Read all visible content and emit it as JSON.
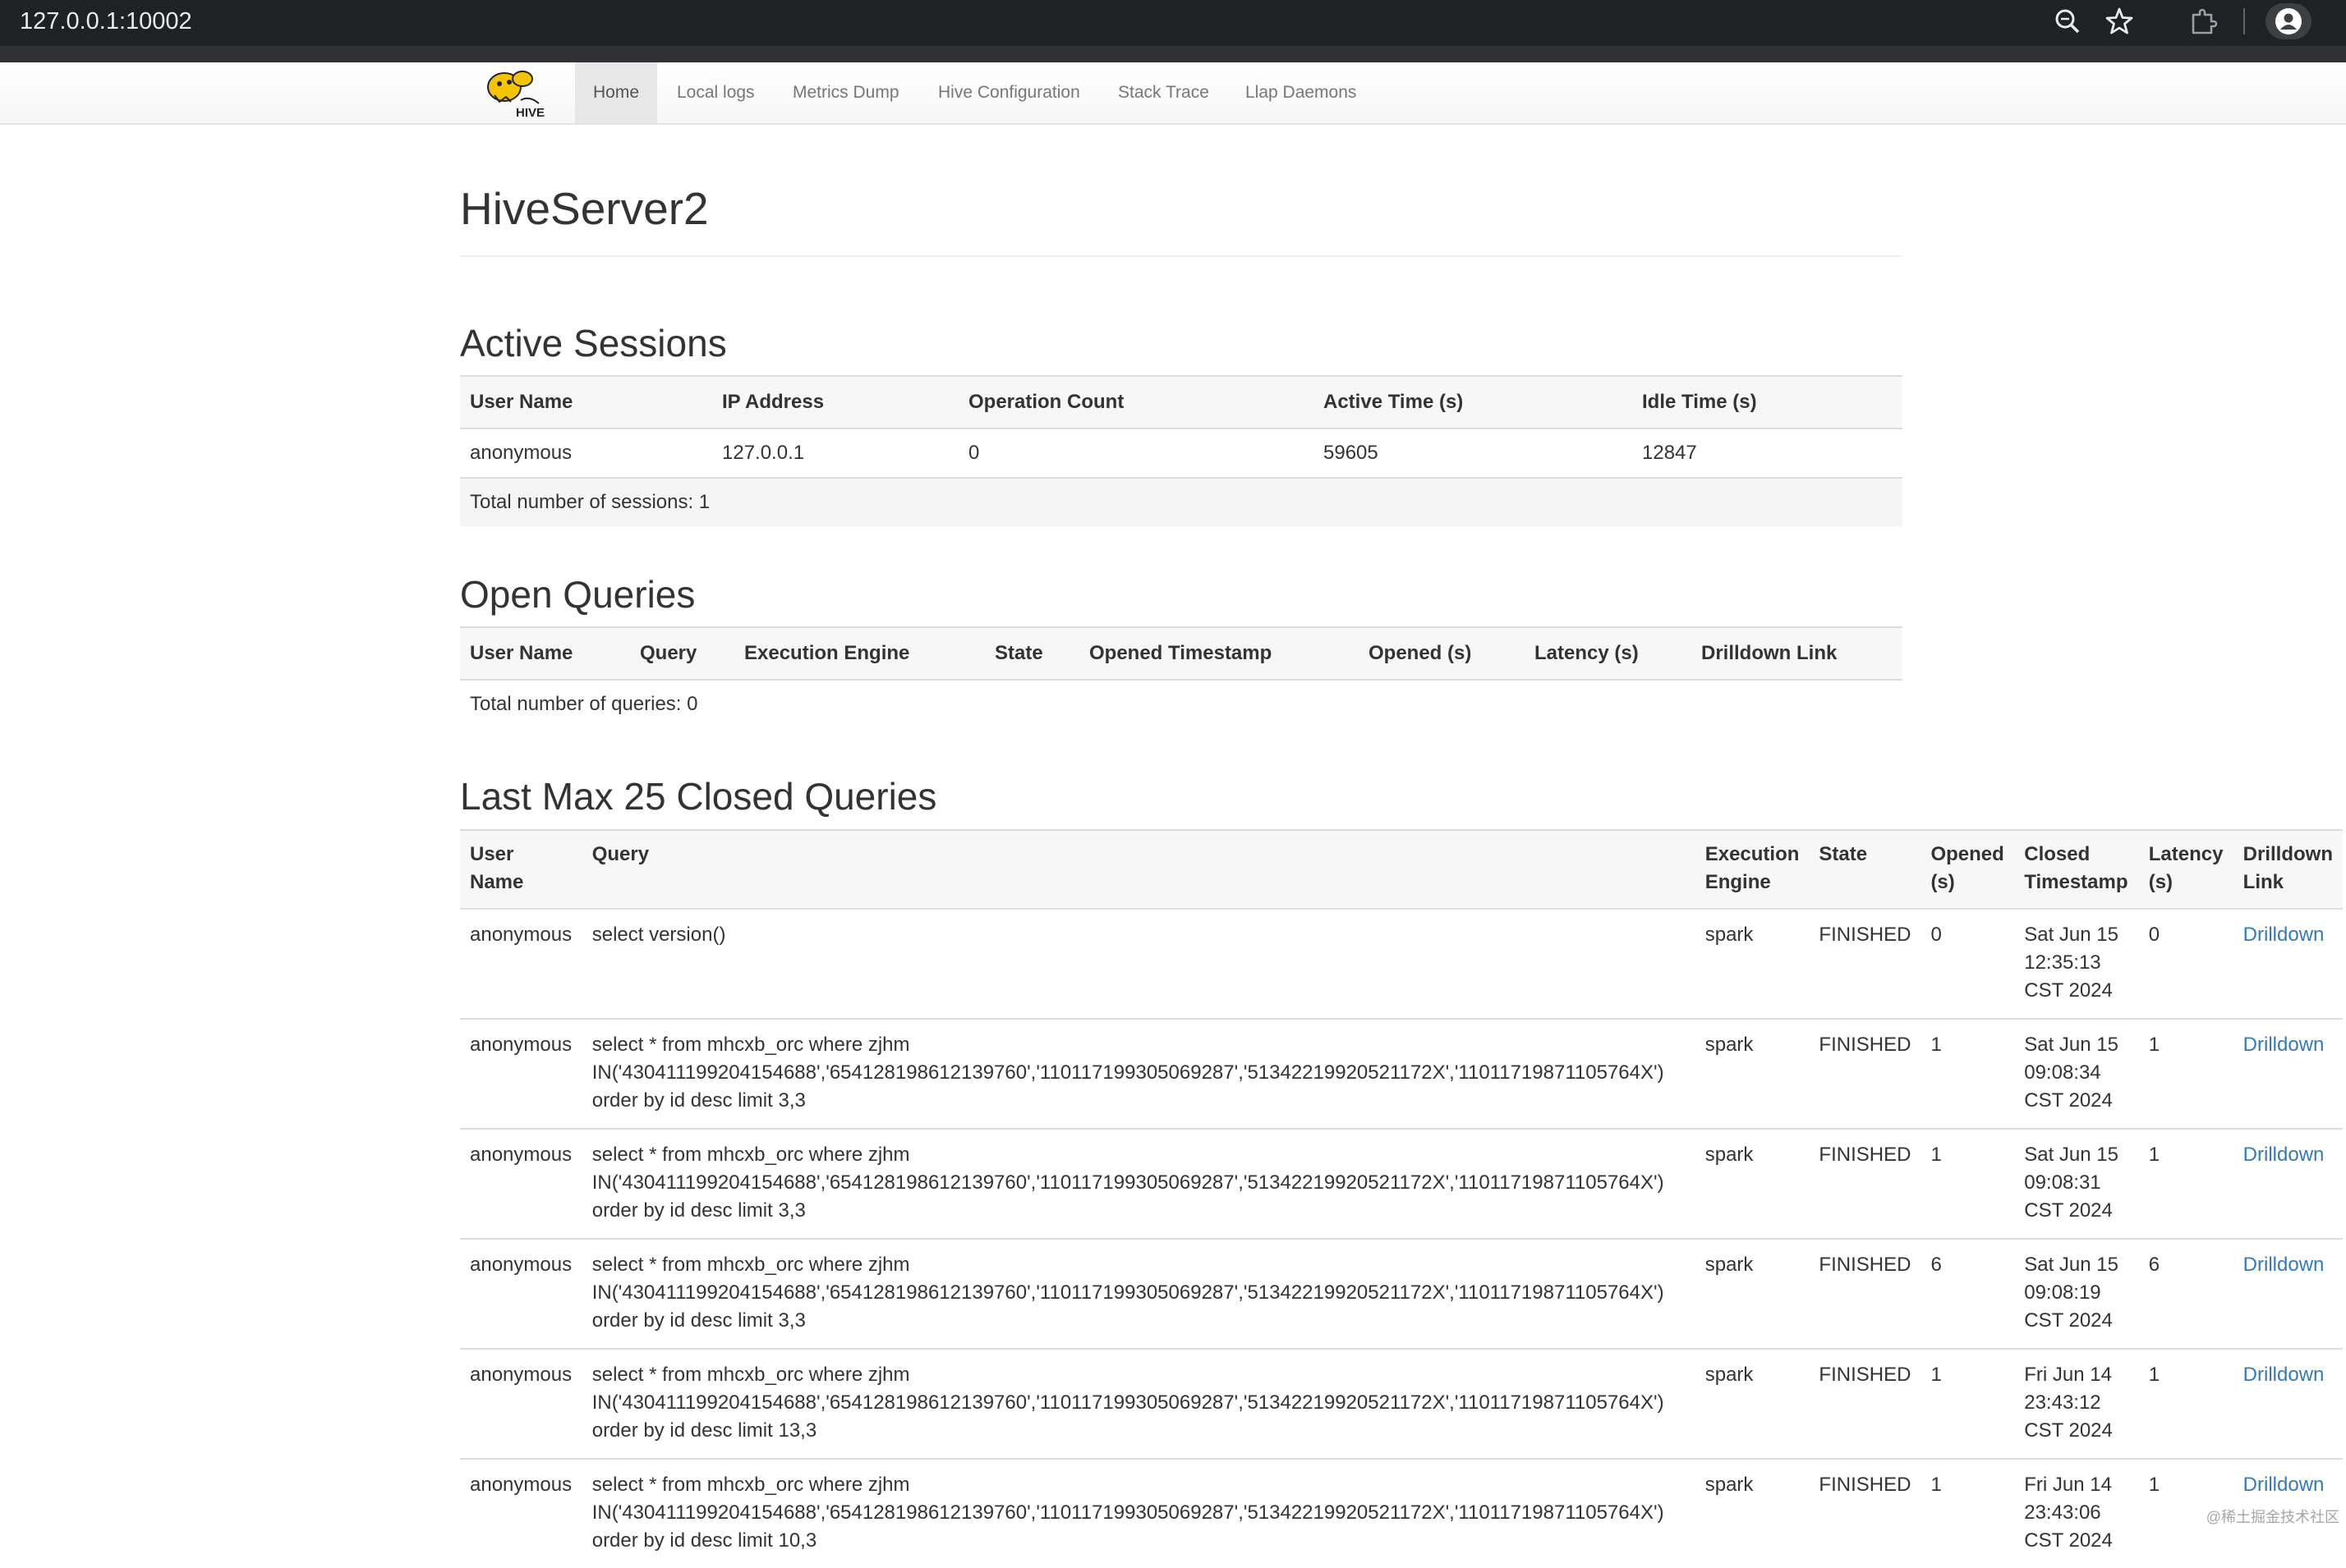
{
  "browser": {
    "url": "127.0.0.1:10002",
    "icons": [
      "zoom-icon",
      "star-icon",
      "extension-icon",
      "profile-icon"
    ]
  },
  "nav": {
    "logo": "hive-logo",
    "items": [
      "Home",
      "Local logs",
      "Metrics Dump",
      "Hive Configuration",
      "Stack Trace",
      "Llap Daemons"
    ],
    "active": "Home"
  },
  "page": {
    "title": "HiveServer2"
  },
  "active_sessions": {
    "title": "Active Sessions",
    "headers": [
      "User Name",
      "IP Address",
      "Operation Count",
      "Active Time (s)",
      "Idle Time (s)"
    ],
    "rows": [
      [
        "anonymous",
        "127.0.0.1",
        "0",
        "59605",
        "12847"
      ]
    ],
    "total": "Total number of sessions: 1"
  },
  "open_queries": {
    "title": "Open Queries",
    "headers": [
      "User Name",
      "Query",
      "Execution Engine",
      "State",
      "Opened Timestamp",
      "Opened (s)",
      "Latency (s)",
      "Drilldown Link"
    ],
    "total": "Total number of queries: 0"
  },
  "closed_queries": {
    "title": "Last Max 25 Closed Queries",
    "headers": {
      "user": [
        "User",
        "Name"
      ],
      "query": [
        "Query"
      ],
      "engine": [
        "Execution",
        "Engine"
      ],
      "state": [
        "State"
      ],
      "opened": [
        "Opened",
        "(s)"
      ],
      "closed": [
        "Closed",
        "Timestamp"
      ],
      "latency": [
        "Latency",
        "(s)"
      ],
      "drill": [
        "Drilldown",
        "Link"
      ]
    },
    "rows": [
      {
        "user": "anonymous",
        "query": [
          "select version()"
        ],
        "engine": "spark",
        "state": "FINISHED",
        "opened": "0",
        "closed": [
          "Sat Jun 15",
          "12:35:13",
          "CST 2024"
        ],
        "latency": "0",
        "drill": "Drilldown"
      },
      {
        "user": "anonymous",
        "query": [
          "select * from mhcxb_orc where zjhm",
          "IN('430411199204154688','654128198612139760','110117199305069287','51342219920521172X','11011719871105764X')",
          "order by id desc limit 3,3"
        ],
        "engine": "spark",
        "state": "FINISHED",
        "opened": "1",
        "closed": [
          "Sat Jun 15",
          "09:08:34",
          "CST 2024"
        ],
        "latency": "1",
        "drill": "Drilldown"
      },
      {
        "user": "anonymous",
        "query": [
          "select * from mhcxb_orc where zjhm",
          "IN('430411199204154688','654128198612139760','110117199305069287','51342219920521172X','11011719871105764X')",
          "order by id desc limit 3,3"
        ],
        "engine": "spark",
        "state": "FINISHED",
        "opened": "1",
        "closed": [
          "Sat Jun 15",
          "09:08:31",
          "CST 2024"
        ],
        "latency": "1",
        "drill": "Drilldown"
      },
      {
        "user": "anonymous",
        "query": [
          "select * from mhcxb_orc where zjhm",
          "IN('430411199204154688','654128198612139760','110117199305069287','51342219920521172X','11011719871105764X')",
          "order by id desc limit 3,3"
        ],
        "engine": "spark",
        "state": "FINISHED",
        "opened": "6",
        "closed": [
          "Sat Jun 15",
          "09:08:19",
          "CST 2024"
        ],
        "latency": "6",
        "drill": "Drilldown"
      },
      {
        "user": "anonymous",
        "query": [
          "select * from mhcxb_orc where zjhm",
          "IN('430411199204154688','654128198612139760','110117199305069287','51342219920521172X','11011719871105764X')",
          "order by id desc limit 13,3"
        ],
        "engine": "spark",
        "state": "FINISHED",
        "opened": "1",
        "closed": [
          "Fri Jun 14",
          "23:43:12",
          "CST 2024"
        ],
        "latency": "1",
        "drill": "Drilldown"
      },
      {
        "user": "anonymous",
        "query": [
          "select * from mhcxb_orc where zjhm",
          "IN('430411199204154688','654128198612139760','110117199305069287','51342219920521172X','11011719871105764X')",
          "order by id desc limit 10,3"
        ],
        "engine": "spark",
        "state": "FINISHED",
        "opened": "1",
        "closed": [
          "Fri Jun 14",
          "23:43:06",
          "CST 2024"
        ],
        "latency": "1",
        "drill": "Drilldown"
      }
    ]
  },
  "watermark": "@稀土掘金技术社区",
  "colors": {
    "link": "#337ab7",
    "chrome": "#202124",
    "nav_active": "#e7e7e7",
    "logo_yellow": "#f3c400"
  }
}
